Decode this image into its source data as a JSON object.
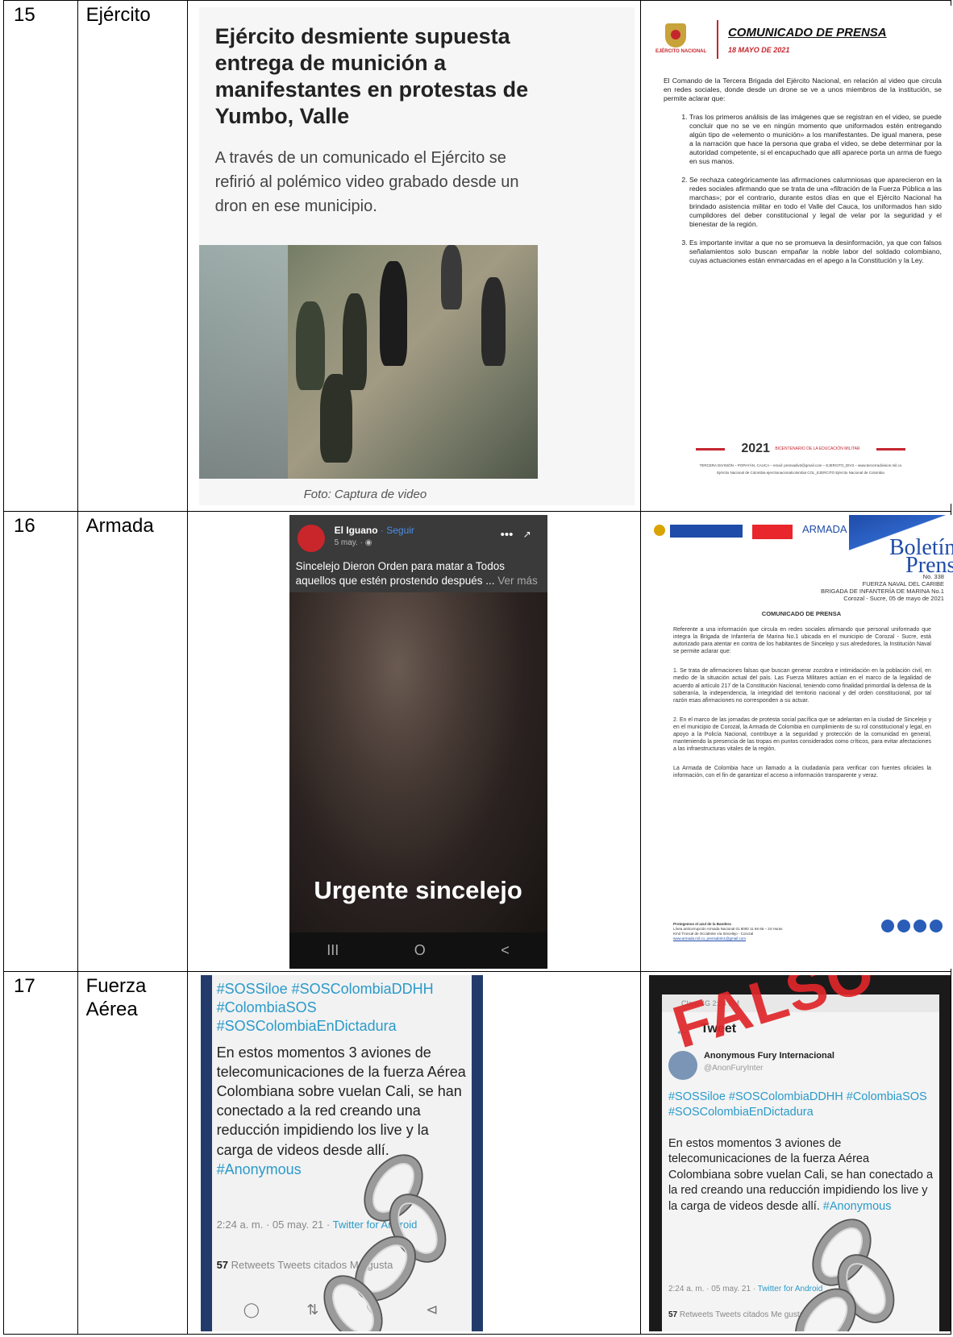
{
  "rows": [
    {
      "num": "15",
      "entity": "Ejército",
      "news": {
        "title": "Ejército desmiente supuesta entrega de munición a manifestantes en protestas de Yumbo, Valle",
        "subtitle": "A través de un comunicado el Ejército se refirió al polémico video grabado desde un dron en ese municipio.",
        "caption": "Foto: Captura de video"
      },
      "communique": {
        "org": "EJÉRCITO NACIONAL",
        "title": "COMUNICADO DE PRENSA",
        "date": "18 MAYO DE 2021",
        "intro": "El Comando de la Tercera Brigada del Ejército Nacional, en relación al video que circula en redes sociales, donde desde un drone se ve a unos miembros de la institución, se permite aclarar que:",
        "points": [
          "Tras los primeros análisis de las imágenes que se registran en el video, se puede concluir que no se ve en ningún momento que uniformados estén entregando algún tipo de «elemento o munición» a los manifestantes. De igual manera, pese a la narración que hace la persona que graba el video, se debe determinar por la autoridad competente, si el encapuchado que allí aparece porta un arma de fuego en sus manos.",
          "Se rechaza categóricamente las afirmaciones calumniosas que aparecieron en la redes sociales afirmando que se trata de una «filtración de la Fuerza Pública a las marchas»; por el contrario, durante estos días en que el Ejército Nacional ha brindado asistencia militar en todo el Valle del Cauca, los uniformados han sido cumplidores del deber constitucional y legal de velar por la seguridad y el bienestar de la región.",
          "Es importante invitar a que no se promueva la desinformación, ya que con falsos señalamientos solo buscan empañar la noble labor del soldado colombiano, cuyas actuaciones están enmarcadas en el apego a la Constitución y la Ley."
        ],
        "footer_year": "2021",
        "footer_small": "BICENTENARIO DE LA EDUCACIÓN MILITAR",
        "footer_line1": "TERCERA DIVISIÓN – POPAYÁN, CAUCA – email: prensadiv3@gmail.com – EJERCITO_DIV3 – www.tercerradivision.mil.co",
        "footer_line2": "Ejército Nacional de Colombia   ejercitonacionalcolombia   COL_EJERCITO   Ejército Nacional de Colombia"
      }
    },
    {
      "num": "16",
      "entity": "Armada",
      "fb": {
        "name": "El Iguano",
        "follow": "· Seguir",
        "date": "5 may. · ",
        "text": "Sincelejo Dieron Orden para matar a Todos aquellos que estén prostendo después ...",
        "more": " Ver más",
        "overlay": "Urgente sincelejo",
        "nav": [
          "III",
          "O",
          "<"
        ]
      },
      "boletin": {
        "brand": "ARMADA DE COLOMBIA",
        "title1": "Boletín",
        "title2": "Prens",
        "num": "No. 338",
        "hd1": "FUERZA NAVAL DEL CARIBE",
        "hd2": "BRIGADA DE INFANTERÍA DE MARINA No.1",
        "hd3": "Corozal - Sucre, 05 de mayo de 2021",
        "cp": "COMUNICADO DE PRENSA",
        "p1": "Referente a una información que circula en redes sociales afirmando que personal uniformado que integra la Brigada de Infantería de Marina No.1 ubicada en el municipio de Corozal - Sucre, está autorizado para atentar en contra de los habitantes de Sincelejo y sus alrededores, la Institución Naval se permite aclarar que:",
        "p2": "1. Se trata de afirmaciones falsas que buscan generar zozobra e intimidación en la población civil, en medio de la situación actual del país. Las Fuerza Militares actúan en el marco de la legalidad de acuerdo al artículo 217 de la Constitución Nacional, teniendo como finalidad primordial la defensa de la soberanía, la independencia, la integridad del territorio nacional y del orden constitucional, por tal razón esas afirmaciones no corresponden a su actuar.",
        "p3": "2. En el marco de las jornadas de protesta social pacífica que se adelantan en la ciudad de Sincelejo y en el municipio de Corozal, la Armada de Colombia en cumplimiento de su rol constitucional y legal, en apoyo a la Policía Nacional, contribuye a la seguridad y protección de la comunidad en general, manteniendo la presencia de las tropas en puntos considerados como críticos, para evitar afectaciones a las infraestructuras vitales de la región.",
        "p4": "La Armada de Colombia hace un llamado a la ciudadanía para verificar con fuentes oficiales la información, con el fin de garantizar el acceso a información transparente y veraz.",
        "ft1": "Protegemos el azul de la Bandera",
        "ft2": "Línea anticorrupción Armada Nacional 01 8000 11 66 66 – 24 Horas",
        "ft3": "Km2 Troncal de Occidente vía Sincelejo - Corozal",
        "ft4": "www.armada.mil.co, prensabim1@gmail.com"
      }
    },
    {
      "num": "17",
      "entity": "Fuerza Aérea",
      "tweet": {
        "hash": "#SOSSiloe #SOSColombiaDDHH #ColombiaSOS #SOSColombiaEnDictadura",
        "msg": "En estos momentos 3 aviones de telecomunicaciones de la fuerza Aérea Colombiana sobre vuelan Cali, se han conectado a la red creando una reducción impidiendo los live y la carga de videos desde allí.",
        "tag": " #Anonymous",
        "meta": "2:24 a. m. · 05 may. 21 · ",
        "via": "Twitter for Android",
        "retweets_n": "57",
        "retweets": " Retweets",
        "quotes": "  Tweets citados",
        "likes": "  Me gusta",
        "tweet_label": "Tweet",
        "account": "Anonymous Fury Internacional",
        "handle": "@AnonFuryInter",
        "status": "Claro  4G  2:24 PM",
        "stamp": "FALSO"
      }
    }
  ]
}
